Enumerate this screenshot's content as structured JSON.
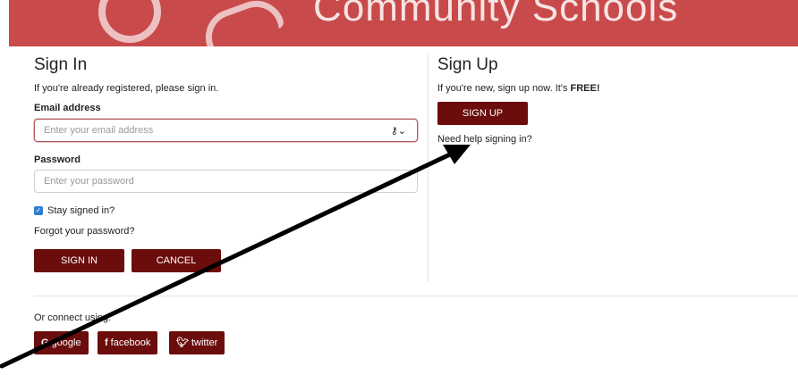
{
  "banner": {
    "text": "Community Schools"
  },
  "signin": {
    "title": "Sign In",
    "subtitle": "If you're already registered, please sign in.",
    "email_label": "Email address",
    "email_placeholder": "Enter your email address",
    "password_label": "Password",
    "password_placeholder": "Enter your password",
    "stay_signed_in": "Stay signed in?",
    "forgot": "Forgot your password?",
    "signin_button": "SIGN IN",
    "cancel_button": "CANCEL",
    "key_icon": "key-icon"
  },
  "signup": {
    "title": "Sign Up",
    "subtitle_prefix": "If you're new, sign up now. It's ",
    "subtitle_bold": "FREE!",
    "button": "SIGN UP",
    "help": "Need help signing in?"
  },
  "connect": {
    "label": "Or connect using:",
    "google": "google",
    "facebook": "facebook",
    "twitter": "twitter"
  },
  "colors": {
    "banner": "#c94a4a",
    "button": "#6b0d0d",
    "checkbox": "#2f7dd1"
  }
}
